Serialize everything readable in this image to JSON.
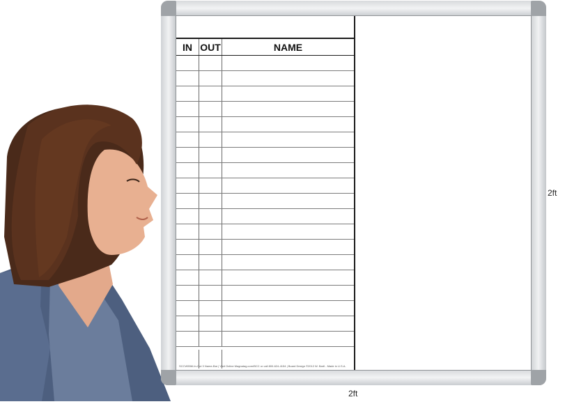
{
  "chart": {
    "headers": {
      "in": "IN",
      "out": "OUT",
      "name": "NAME"
    },
    "row_count": 19,
    "fine_print": "SCCW55M-In-Out 3 Name-Bar | Visit Online Magnatag.com/BCC or call 800-624-4154 | Board Design ©2012 W. Bartl - Made in U.S.A."
  },
  "dimensions": {
    "height": "2ft",
    "width": "2ft"
  }
}
